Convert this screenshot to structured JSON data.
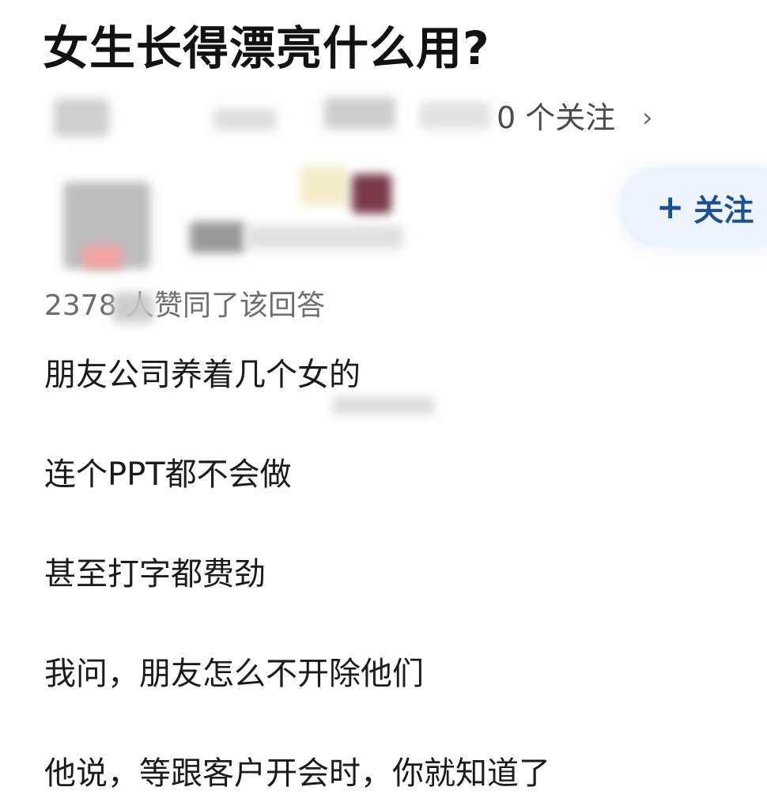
{
  "question": {
    "title": "女生长得漂亮什么用?"
  },
  "topic": {
    "follow_count_text": "0 个关注",
    "chevron": "›"
  },
  "author": {
    "follow_label": "关注",
    "follow_icon": "+"
  },
  "answer": {
    "votes_text": "2378 人赞同了该回答",
    "paragraphs": [
      "朋友公司养着几个女的",
      "连个PPT都不会做",
      "甚至打字都费劲",
      "我问，朋友怎么不开除他们",
      "他说，等跟客户开会时，你就知道了"
    ]
  },
  "colors": {
    "accent": "#1f4f8b",
    "follow_bg": "#edf3fb",
    "muted_text": "#6d6d6d"
  }
}
